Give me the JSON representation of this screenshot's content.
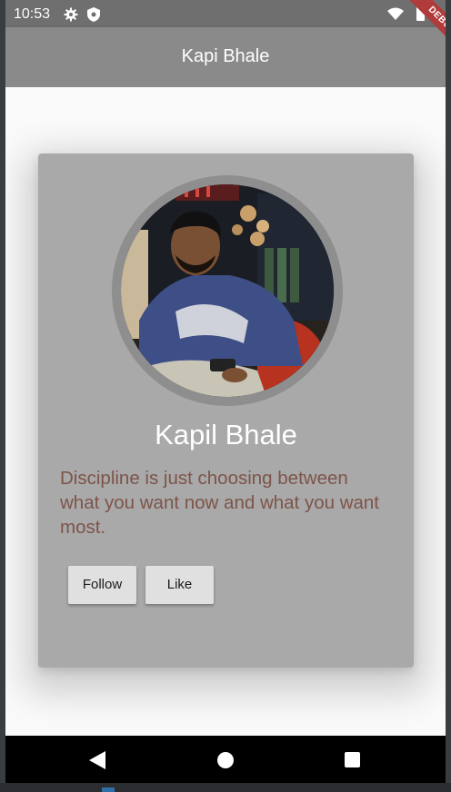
{
  "status_bar": {
    "time": "10:53",
    "icons": [
      "settings-gear-icon",
      "shield-icon",
      "wifi-icon",
      "battery-icon"
    ]
  },
  "app_bar": {
    "title": "Kapi Bhale",
    "background": "#8a8a8a"
  },
  "debug_banner": {
    "label": "DEBUG",
    "color": "#b13a3a"
  },
  "profile_card": {
    "background": "#a9a9a9",
    "avatar_icon": "profile-photo",
    "name": "Kapil Bhale",
    "quote": "Discipline is just choosing between what you want now and what you want most.",
    "quote_color": "#7d5449",
    "buttons": {
      "follow_label": "Follow",
      "like_label": "Like"
    }
  },
  "nav_bar": {
    "icons": [
      "back-icon",
      "home-icon",
      "recent-apps-icon"
    ]
  }
}
